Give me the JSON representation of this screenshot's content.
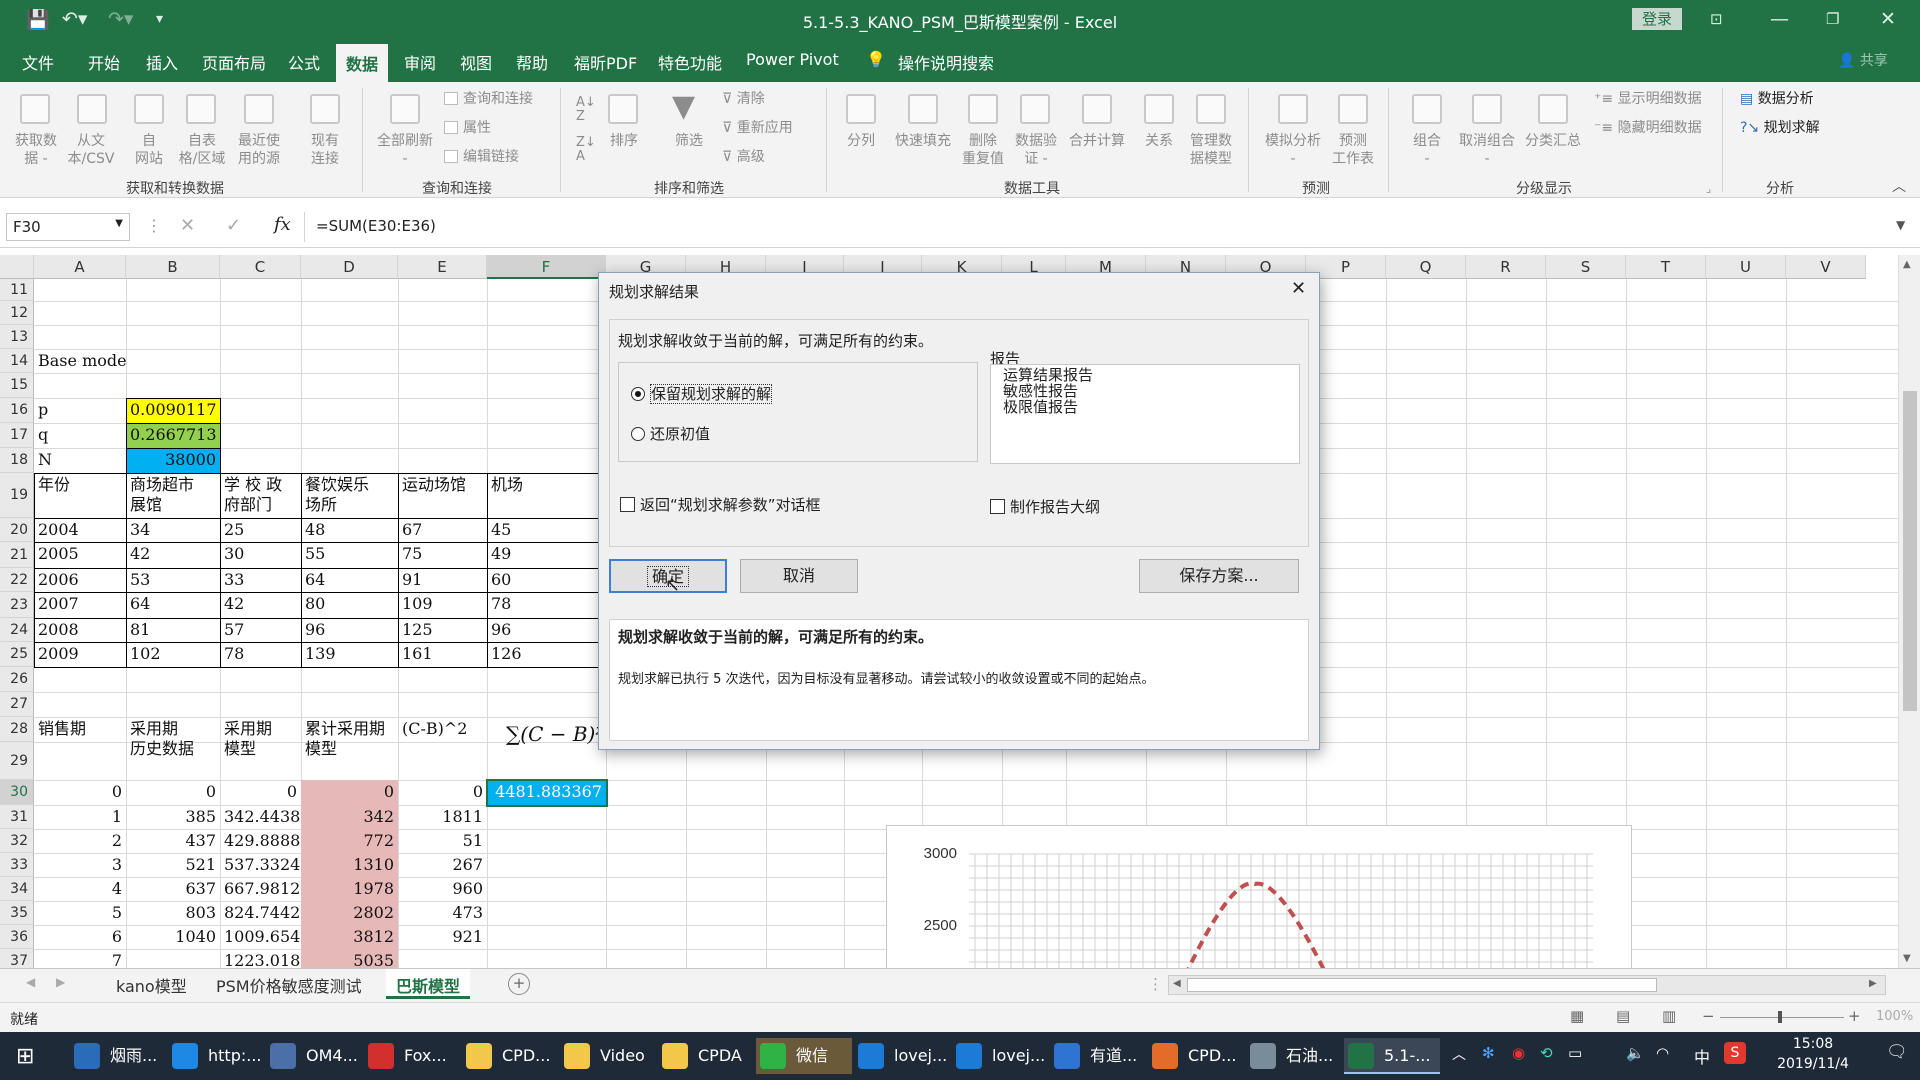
{
  "window": {
    "title": "5.1-5.3_KANO_PSM_巴斯模型案例 - Excel",
    "login_label": "登录"
  },
  "ribbon_tabs": [
    "文件",
    "开始",
    "插入",
    "页面布局",
    "公式",
    "数据",
    "审阅",
    "视图",
    "帮助",
    "福昕PDF",
    "特色功能",
    "Power Pivot",
    "操作说明搜索"
  ],
  "share_label": "共享",
  "ribbon": {
    "get_data": [
      "获取数",
      "据 -"
    ],
    "from_text": [
      "从文",
      "本/CSV"
    ],
    "from_web": [
      "自",
      "网站"
    ],
    "from_table": [
      "自表",
      "格/区域"
    ],
    "recent_sources": [
      "最近使",
      "用的源"
    ],
    "existing_conn": [
      "现有",
      "连接"
    ],
    "refresh_all": [
      "全部刷新"
    ],
    "queries_conn": "查询和连接",
    "properties": "属性",
    "edit_links": "编辑链接",
    "sort": "排序",
    "filter": "筛选",
    "clear": "清除",
    "reapply": "重新应用",
    "advanced": "高级",
    "split": "分列",
    "flash_fill": "快速填充",
    "remove_dup": [
      "删除",
      "重复值"
    ],
    "data_validation": [
      "数据验",
      "证 -"
    ],
    "consolidate": "合并计算",
    "relations": "关系",
    "manage_model": [
      "管理数",
      "据模型"
    ],
    "what_if": [
      "模拟分析"
    ],
    "forecast": [
      "预测",
      "工作表"
    ],
    "group": "组合",
    "ungroup": "取消组合",
    "subtotal": "分类汇总",
    "show_detail": "显示明细数据",
    "hide_detail": "隐藏明细数据",
    "data_analysis": "数据分析",
    "solver": "规划求解",
    "groups": [
      "获取和转换数据",
      "查询和连接",
      "排序和筛选",
      "数据工具",
      "预测",
      "分级显示",
      "分析"
    ]
  },
  "formula_bar": {
    "name_box": "F30",
    "formula": "=SUM(E30:E36)"
  },
  "columns": [
    "A",
    "B",
    "C",
    "D",
    "E",
    "F",
    "G",
    "H",
    "I",
    "J",
    "K",
    "L",
    "M",
    "N",
    "O",
    "P",
    "Q",
    "R",
    "S",
    "T",
    "U",
    "V"
  ],
  "rows": [
    "11",
    "12",
    "13",
    "14",
    "15",
    "16",
    "17",
    "18",
    "19",
    "20",
    "21",
    "22",
    "23",
    "24",
    "25",
    "26",
    "27",
    "28",
    "29",
    "30",
    "31",
    "32",
    "33",
    "34",
    "35",
    "36",
    "37"
  ],
  "cells": {
    "a14": "Base model",
    "a16": "p",
    "b16": "0.0090117",
    "a17": "q",
    "b17": "0.2667713",
    "a18": "N",
    "b18": "38000",
    "hdr19": [
      "年份",
      "商场超市\n展馆",
      "学 校 政\n府部门",
      "餐饮娱乐\n场所",
      "运动场馆",
      "机场"
    ],
    "table": [
      [
        "2004",
        "34",
        "25",
        "48",
        "67",
        "45"
      ],
      [
        "2005",
        "42",
        "30",
        "55",
        "75",
        "49"
      ],
      [
        "2006",
        "53",
        "33",
        "64",
        "91",
        "60"
      ],
      [
        "2007",
        "64",
        "42",
        "80",
        "109",
        "78"
      ],
      [
        "2008",
        "81",
        "57",
        "96",
        "125",
        "96"
      ],
      [
        "2009",
        "102",
        "78",
        "139",
        "161",
        "126"
      ]
    ],
    "hdr28": [
      "销售期",
      "采用期\n历史数据",
      "采用期\n模型",
      "累计采用期\n模型",
      "(C-B)^2"
    ],
    "formula_label": "∑(C − B)²",
    "rows30": [
      [
        "0",
        "0",
        "0",
        "0",
        "0"
      ],
      [
        "1",
        "385",
        "342.4438",
        "342",
        "1811"
      ],
      [
        "2",
        "437",
        "429.8888",
        "772",
        "51"
      ],
      [
        "3",
        "521",
        "537.3324",
        "1310",
        "267"
      ],
      [
        "4",
        "637",
        "667.9812",
        "1978",
        "960"
      ],
      [
        "5",
        "803",
        "824.7442",
        "2802",
        "473"
      ],
      [
        "6",
        "1040",
        "1009.654",
        "3812",
        "921"
      ],
      [
        "7",
        "",
        "1223.018",
        "5035",
        ""
      ]
    ],
    "f30": "4481.883367"
  },
  "chart": {
    "y_ticks": [
      "3000",
      "2500"
    ]
  },
  "dialog": {
    "title": "规划求解结果",
    "message": "规划求解收敛于当前的解，可满足所有的约束。",
    "keep_solution": "保留规划求解的解",
    "restore_values": "还原初值",
    "reports_label": "报告",
    "reports": [
      "运算结果报告",
      "敏感性报告",
      "极限值报告"
    ],
    "return_dialog": "返回“规划求解参数”对话框",
    "outline_reports": "制作报告大纲",
    "ok": "确定",
    "cancel": "取消",
    "save_scenario": "保存方案...",
    "info_title": "规划求解收敛于当前的解，可满足所有的约束。",
    "info_text": "规划求解已执行 5 次迭代，因为目标没有显著移动。请尝试较小的收敛设置或不同的起始点。"
  },
  "sheet_tabs": [
    "kano模型",
    "PSM价格敏感度测试",
    "巴斯模型"
  ],
  "status": {
    "ready": "就绪",
    "zoom": "100%"
  },
  "taskbar": {
    "items": [
      "烟雨...",
      "http:...",
      "OM4...",
      "Fox...",
      "CPD...",
      "Video",
      "CPDA",
      "微信",
      "lovej...",
      "lovej...",
      "有道...",
      "CPD...",
      "石油...",
      "5.1-..."
    ],
    "time": "15:08",
    "date": "2019/11/4",
    "ime": "中"
  },
  "colors": {
    "excel_green": "#217346",
    "yellow": "#ffff00",
    "green": "#92d050",
    "blue": "#00b0f0",
    "pink": "#e6b8b7",
    "red_dash": "#c0504d"
  }
}
